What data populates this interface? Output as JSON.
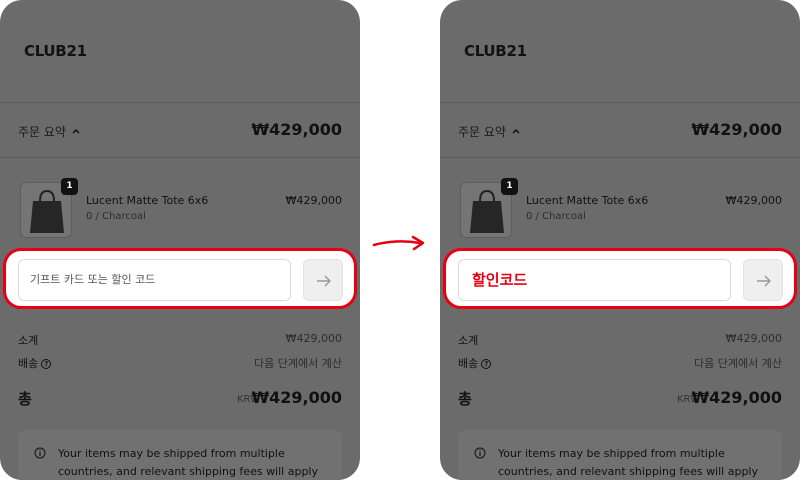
{
  "brand": {
    "logo": "CLUB21"
  },
  "order_summary": {
    "label": "주문 요약",
    "total": "₩429,000"
  },
  "product": {
    "quantity": "1",
    "name": "Lucent Matte Tote 6x6",
    "variant": "0 / Charcoal",
    "price": "₩429,000"
  },
  "discount": {
    "placeholder": "기프트 카드 또는 할인 코드",
    "annotation": "할인코드"
  },
  "lines": {
    "subtotal_label": "소계",
    "subtotal_value": "₩429,000",
    "shipping_label": "배송",
    "shipping_value": "다음 단계에서 계산"
  },
  "total": {
    "label": "총",
    "currency": "KRW",
    "value": "₩429,000"
  },
  "notice": {
    "text": "Your items may be shipped from multiple countries, and relevant shipping fees will apply at"
  },
  "colors": {
    "highlight": "#e60012",
    "overlay": "#6b6b6b"
  }
}
